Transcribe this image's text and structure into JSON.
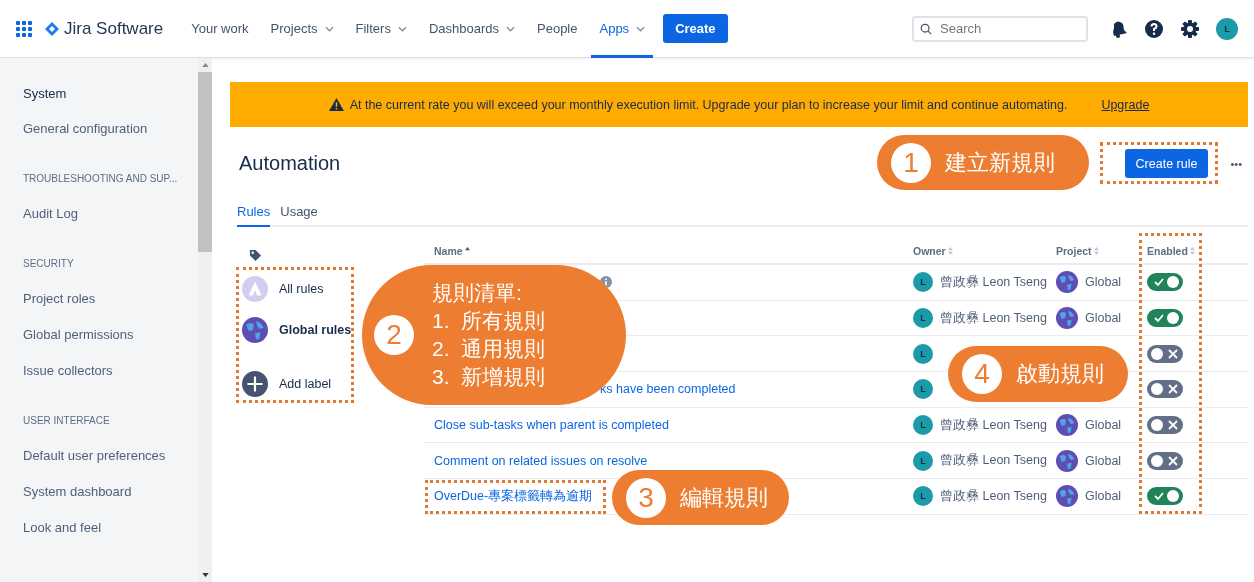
{
  "nav": {
    "app_name": "Jira Software",
    "items": [
      {
        "label": "Your work",
        "dropdown": false,
        "selected": false
      },
      {
        "label": "Projects",
        "dropdown": true,
        "selected": false
      },
      {
        "label": "Filters",
        "dropdown": true,
        "selected": false
      },
      {
        "label": "Dashboards",
        "dropdown": true,
        "selected": false
      },
      {
        "label": "People",
        "dropdown": false,
        "selected": false
      },
      {
        "label": "Apps",
        "dropdown": true,
        "selected": true
      }
    ],
    "create": "Create",
    "search_placeholder": "Search",
    "avatar": "L"
  },
  "sidebar": [
    {
      "title": "System",
      "kind": "title",
      "items": [
        "General configuration"
      ]
    },
    {
      "title": "TROUBLESHOOTING AND SUP...",
      "kind": "caps",
      "items": [
        "Audit Log"
      ]
    },
    {
      "title": "SECURITY",
      "kind": "caps",
      "items": [
        "Project roles",
        "Global permissions",
        "Issue collectors"
      ]
    },
    {
      "title": "USER INTERFACE",
      "kind": "caps",
      "items": [
        "Default user preferences",
        "System dashboard",
        "Look and feel"
      ]
    }
  ],
  "banner": {
    "message": "At the current rate you will exceed your monthly execution limit. Upgrade your plan to increase your limit and continue automating.",
    "link": "Upgrade"
  },
  "page": {
    "title": "Automation",
    "create_button": "Create rule",
    "more": "•••",
    "tabs": [
      {
        "label": "Rules",
        "selected": true
      },
      {
        "label": "Usage",
        "selected": false
      }
    ]
  },
  "labels": [
    {
      "label": "All rules",
      "kind": "all",
      "selected": false
    },
    {
      "label": "Global rules",
      "kind": "global",
      "selected": true
    },
    {
      "label": "Add label",
      "kind": "add",
      "selected": false
    }
  ],
  "table": {
    "columns": [
      {
        "label": "Name",
        "sorted": true
      },
      {
        "label": "Owner",
        "sorted": false
      },
      {
        "label": "Project",
        "sorted": false
      },
      {
        "label": "Enabled",
        "sorted": false
      }
    ],
    "rows": [
      {
        "info": true,
        "owner_initial": "L",
        "owner": "曾政彝 Leon Tseng",
        "project": "Global",
        "enabled": true
      },
      {
        "owner_initial": "L",
        "owner": "曾政彝 Leon Tseng",
        "project": "Global",
        "enabled": true
      },
      {
        "owner_initial": "L",
        "enabled": false
      },
      {
        "name": "ks have been completed",
        "owner_initial": "L",
        "enabled": false
      },
      {
        "name": "Close sub-tasks when parent is completed",
        "owner_initial": "L",
        "owner": "曾政彝 Leon Tseng",
        "project": "Global",
        "enabled": false
      },
      {
        "name": "Comment on related issues on resolve",
        "owner_initial": "L",
        "owner": "曾政彝 Leon Tseng",
        "project": "Global",
        "enabled": false
      },
      {
        "name": "OverDue-專案標籤轉為逾期",
        "owner_initial": "L",
        "owner": "曾政彝 Leon Tseng",
        "project": "Global",
        "enabled": true
      }
    ]
  },
  "callouts": [
    {
      "number": "1",
      "lines": [
        "建立新規則"
      ]
    },
    {
      "number": "2",
      "lines": [
        "規則清單:",
        "1.  所有規則",
        "2.  通用規則",
        "3.  新增規則"
      ]
    },
    {
      "number": "3",
      "lines": [
        "編輯規則"
      ]
    },
    {
      "number": "4",
      "lines": [
        "啟動規則"
      ]
    }
  ]
}
